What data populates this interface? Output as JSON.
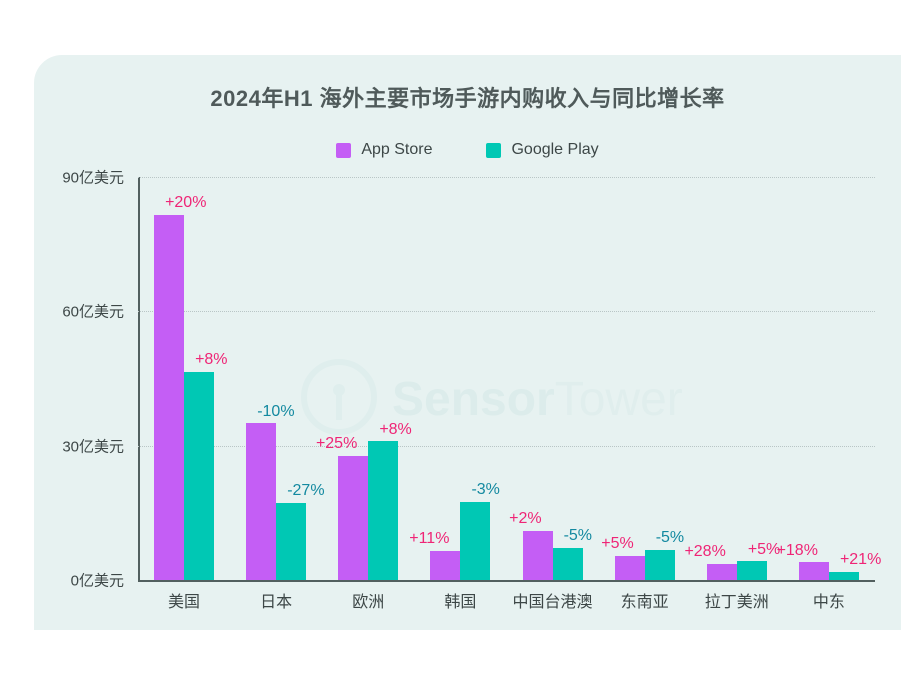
{
  "chart_data": {
    "type": "bar",
    "title": "2024年H1 海外主要市场手游内购收入与同比增长率",
    "xlabel": "",
    "ylabel": "",
    "ylim": [
      0,
      90
    ],
    "grid": true,
    "legend_position": "top-center",
    "y_ticks": [
      "0亿美元",
      "30亿美元",
      "60亿美元",
      "90亿美元"
    ],
    "y_tick_values": [
      0,
      30,
      60,
      90
    ],
    "categories": [
      "美国",
      "日本",
      "欧洲",
      "韩国",
      "中国台港澳",
      "东南亚",
      "拉丁美洲",
      "中东"
    ],
    "series": [
      {
        "name": "App Store",
        "color": "#c45ef5",
        "values": [
          81.5,
          35.0,
          27.8,
          6.5,
          11.0,
          5.4,
          3.6,
          4.0
        ],
        "labels": [
          "+20%",
          "-10%",
          "+25%",
          "+11%",
          "+2%",
          "+5%",
          "+28%",
          "+18%"
        ],
        "label_signs": [
          "pos",
          "neg",
          "pos",
          "pos",
          "pos",
          "pos",
          "pos",
          "pos"
        ]
      },
      {
        "name": "Google Play",
        "color": "#00c8b4",
        "values": [
          46.5,
          17.2,
          31.0,
          17.5,
          7.2,
          6.7,
          4.2,
          1.8
        ],
        "labels": [
          "+8%",
          "-27%",
          "+8%",
          "-3%",
          "-5%",
          "-5%",
          "+5%",
          "+21%"
        ],
        "label_signs": [
          "pos",
          "neg",
          "pos",
          "neg",
          "neg",
          "neg",
          "pos",
          "pos"
        ]
      }
    ]
  },
  "legend": {
    "items": [
      {
        "label": "App Store",
        "color": "#c45ef5"
      },
      {
        "label": "Google Play",
        "color": "#00c8b4"
      }
    ]
  },
  "watermark": {
    "bold_text": "Sensor",
    "light_text": "Tower"
  },
  "colors": {
    "app_store": "#c45ef5",
    "google_play": "#00c8b4",
    "card_background": "#e7f2f1",
    "growth_positive": "#ef2576",
    "growth_negative": "#1389a0",
    "axis": "#52605f"
  }
}
